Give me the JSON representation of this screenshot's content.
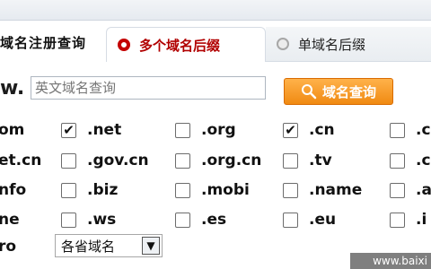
{
  "header": {
    "title": "域名注册查询"
  },
  "tabs": [
    {
      "label": "多个域名后缀",
      "active": true
    },
    {
      "label": "单域名后缀",
      "active": false
    }
  ],
  "search": {
    "prefix": "w.",
    "placeholder": "英文域名查询",
    "button_label": "域名查询"
  },
  "domain_rows": [
    {
      "label": "om",
      "items": [
        {
          "label": ".net",
          "checked": true
        },
        {
          "label": ".org",
          "checked": false
        },
        {
          "label": ".cn",
          "checked": true
        },
        {
          "label": ".c",
          "checked": false
        }
      ]
    },
    {
      "label": "et.cn",
      "items": [
        {
          "label": ".gov.cn",
          "checked": false
        },
        {
          "label": ".org.cn",
          "checked": false
        },
        {
          "label": ".tv",
          "checked": false
        },
        {
          "label": ".c",
          "checked": false
        }
      ]
    },
    {
      "label": "nfo",
      "items": [
        {
          "label": ".biz",
          "checked": false
        },
        {
          "label": ".mobi",
          "checked": false
        },
        {
          "label": ".name",
          "checked": false
        },
        {
          "label": ".a",
          "checked": false
        }
      ]
    },
    {
      "label": "ne",
      "items": [
        {
          "label": ".ws",
          "checked": false
        },
        {
          "label": ".es",
          "checked": false
        },
        {
          "label": ".eu",
          "checked": false
        },
        {
          "label": ".i",
          "checked": false
        }
      ]
    }
  ],
  "last_row": {
    "label": "ro",
    "select_value": "各省域名"
  },
  "watermark": "www.baixi",
  "colors": {
    "accent_red": "#c40000",
    "button_orange": "#f08a12"
  }
}
